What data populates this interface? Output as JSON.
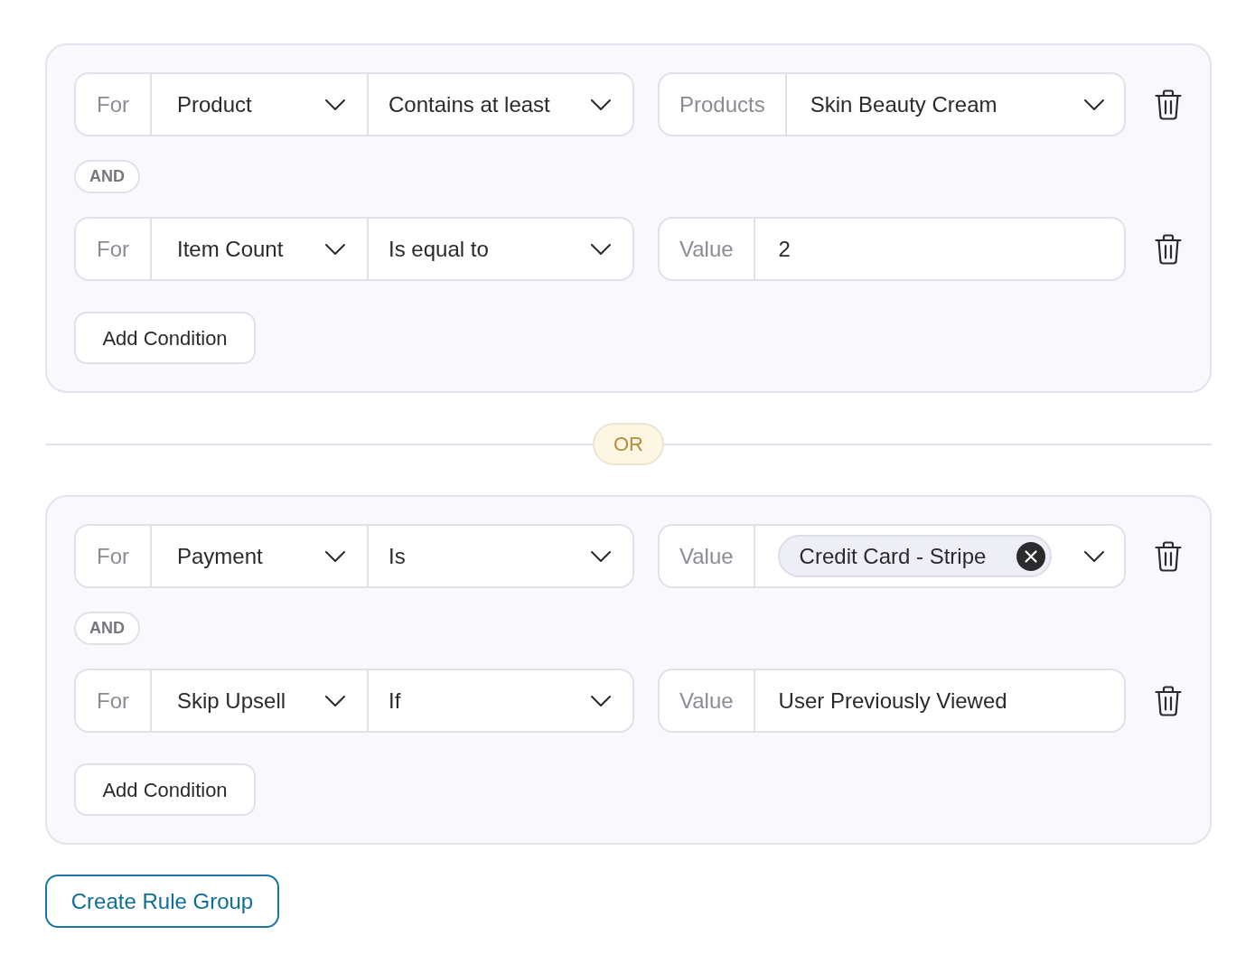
{
  "rule_groups": [
    {
      "conditions": [
        {
          "for_label": "For",
          "field": "Product",
          "operator": "Contains at least",
          "value_label": "Products",
          "value": {
            "kind": "select",
            "text": "Skin Beauty Cream"
          }
        },
        {
          "joiner": "AND",
          "for_label": "For",
          "field": "Item Count",
          "operator": "Is equal to",
          "value_label": "Value",
          "value": {
            "kind": "input",
            "text": "2"
          }
        }
      ],
      "add_button": "Add Condition"
    },
    {
      "joiner": "OR",
      "conditions": [
        {
          "for_label": "For",
          "field": "Payment",
          "operator": "Is",
          "value_label": "Value",
          "value": {
            "kind": "tags",
            "tags": [
              "Credit Card - Stripe"
            ]
          }
        },
        {
          "joiner": "AND",
          "for_label": "For",
          "field": "Skip Upsell",
          "operator": "If",
          "value_label": "Value",
          "value": {
            "kind": "input",
            "text": "User Previously Viewed"
          }
        }
      ],
      "add_button": "Add Condition"
    }
  ],
  "create_button": "Create Rule Group"
}
